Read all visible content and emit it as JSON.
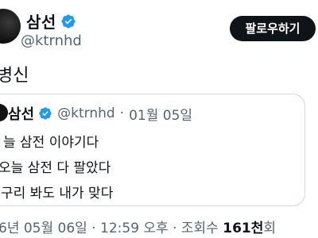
{
  "author": {
    "name": "삼선",
    "handle": "@ktrnhd"
  },
  "follow_label": "팔로우하기",
  "post_text": "병신",
  "quoted": {
    "name": "삼선",
    "handle": "@ktrnhd",
    "separator": "·",
    "date": "01월 05일",
    "lines": [
      "늘 삼전 이야기다",
      "오늘 삼전 다 팔았다",
      "구리 봐도 내가 맞다"
    ]
  },
  "footer": {
    "timestamp": "6년 05월 06일 · 12:59 오후 · 조회수",
    "views": "161천",
    "views_suffix": "회"
  },
  "colors": {
    "verified": "#1d9bf0",
    "text": "#0f1419",
    "muted": "#536471",
    "button_bg": "#0f1419"
  }
}
